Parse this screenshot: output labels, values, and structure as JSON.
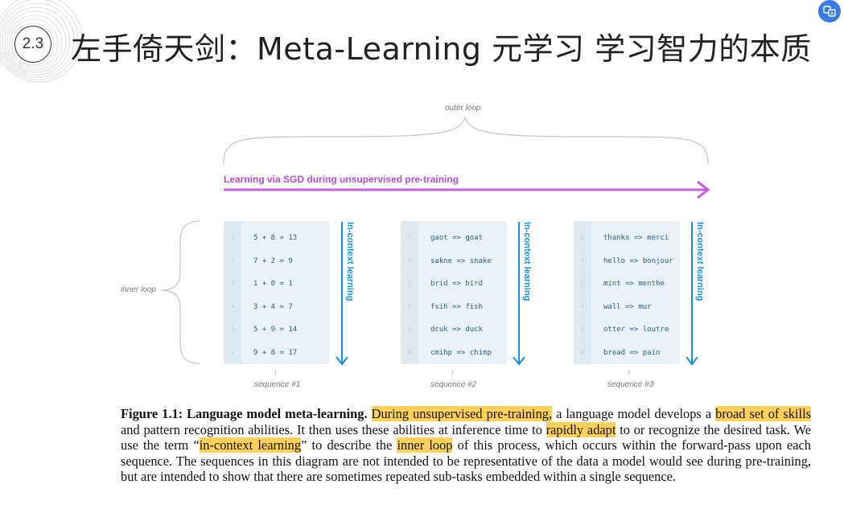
{
  "header": {
    "section_number": "2.3",
    "title": "左手倚天剑：Meta-Learning 元学习 学习智力的本质"
  },
  "diagram": {
    "outer_loop_label": "outer loop",
    "inner_loop_label": "inner loop",
    "sgd_label": "Learning via SGD during unsupervised pre-training",
    "icl_label": "In-context learning",
    "sequences": [
      {
        "label": "sequence #1",
        "lines": [
          "5 + 8 = 13",
          "7 + 2 = 9",
          "1 + 0 = 1",
          "3 + 4 = 7",
          "5 + 9 = 14",
          "9 + 8 = 17"
        ]
      },
      {
        "label": "sequence #2",
        "lines": [
          "gaot => goat",
          "sakne => snake",
          "brid => bird",
          "fsih => fish",
          "dcuk => duck",
          "cmihp => chimp"
        ]
      },
      {
        "label": "sequence #3",
        "lines": [
          "thanks => merci",
          "hello => bonjour",
          "mint => menthe",
          "wall => mur",
          "otter => loutre",
          "bread => pain"
        ]
      }
    ],
    "line_numbers": [
      "1",
      "2",
      "3",
      "4",
      "5",
      "6"
    ]
  },
  "caption": {
    "lead": "Figure 1.1: Language model meta-learning.",
    "hl1": "During unsupervised pre-training,",
    "t1": " a language model develops a ",
    "hl2": "broad set of skills",
    "t2": " and pattern recognition abilities. It then uses these abilities at inference time to ",
    "hl3": "rapidly adapt",
    "t3": " to or recognize the desired task. We use the term “",
    "hl4": "in-context learning",
    "t4": "” to describe the ",
    "hl5": "inner loop",
    "t5": " of this process, which occurs within the forward-pass upon each sequence. The sequences in this diagram are not intended to be representative of the data a model would see during pre-training, but are intended to show that there are sometimes repeated sub-tasks embedded within a single sequence."
  },
  "colors": {
    "sgd_arrow": "#c45fe0",
    "icl_arrow": "#1a90d9",
    "highlight": "#ffd05a",
    "box_bg": "#e8f2f8"
  },
  "icons": {
    "corner": "translate-icon"
  }
}
